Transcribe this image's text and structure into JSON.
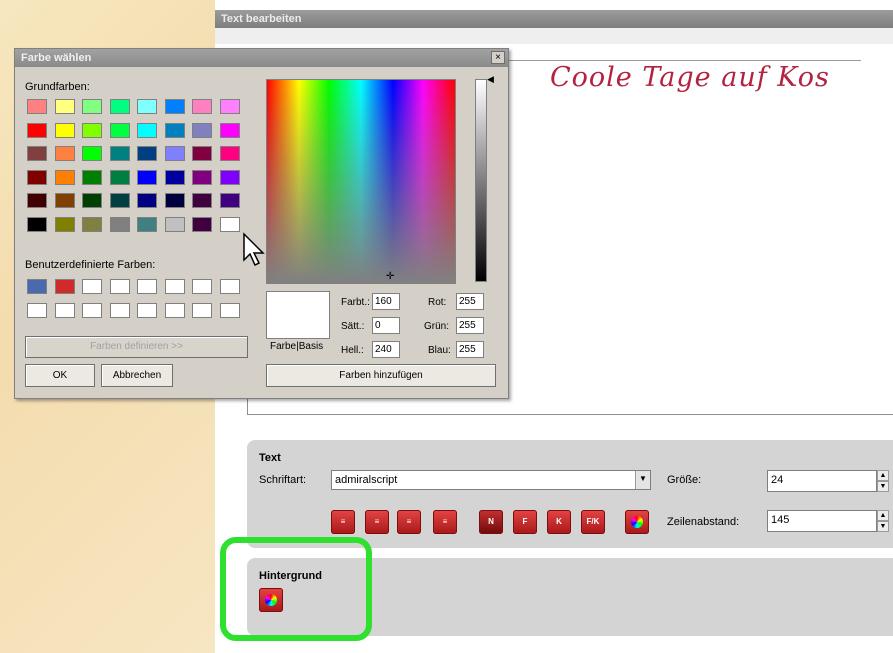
{
  "main_window": {
    "title": "Text bearbeiten",
    "canvas_text": "Coole Tage auf Kos"
  },
  "text_panel": {
    "heading": "Text",
    "font_label": "Schriftart:",
    "font_value": "admiralscript",
    "size_label": "Größe:",
    "size_value": "24",
    "line_spacing_label": "Zeilenabstand:",
    "line_spacing_value": "145",
    "format_buttons": [
      "align-left",
      "align-center",
      "align-right",
      "justify",
      "normal",
      "bold",
      "italic",
      "bold-italic",
      "color"
    ],
    "format_button_labels": [
      "≡",
      "≡",
      "≡",
      "≡",
      "N",
      "F",
      "K",
      "F/K",
      ""
    ]
  },
  "background_panel": {
    "heading": "Hintergrund"
  },
  "highlight_color": "#2fe02f",
  "color_dialog": {
    "title": "Farbe wählen",
    "close_label": "×",
    "basic_colors_label": "Grundfarben:",
    "basic_colors": [
      [
        "#ff8080",
        "#ffff80",
        "#80ff80",
        "#00ff80",
        "#80ffff",
        "#0080ff",
        "#ff80c0",
        "#ff80ff"
      ],
      [
        "#ff0000",
        "#ffff00",
        "#80ff00",
        "#00ff40",
        "#00ffff",
        "#0080c0",
        "#8080c0",
        "#ff00ff"
      ],
      [
        "#804040",
        "#ff8040",
        "#00ff00",
        "#008080",
        "#004080",
        "#8080ff",
        "#800040",
        "#ff0080"
      ],
      [
        "#800000",
        "#ff8000",
        "#008000",
        "#008040",
        "#0000ff",
        "#0000a0",
        "#800080",
        "#8000ff"
      ],
      [
        "#400000",
        "#804000",
        "#004000",
        "#004040",
        "#000080",
        "#000040",
        "#400040",
        "#400080"
      ],
      [
        "#000000",
        "#808000",
        "#808040",
        "#808080",
        "#408080",
        "#c0c0c0",
        "#400040",
        "#ffffff"
      ]
    ],
    "custom_colors_label": "Benutzerdefinierte Farben:",
    "custom_colors": [
      [
        "#4a6ab0",
        "#d02a2a",
        "#ffffff",
        "#ffffff",
        "#ffffff",
        "#ffffff",
        "#ffffff",
        "#ffffff"
      ],
      [
        "#ffffff",
        "#ffffff",
        "#ffffff",
        "#ffffff",
        "#ffffff",
        "#ffffff",
        "#ffffff",
        "#ffffff"
      ]
    ],
    "define_custom_label": "Farben definieren >>",
    "ok_label": "OK",
    "cancel_label": "Abbrechen",
    "color_solid_label": "Farbe|Basis",
    "hue_label": "Farbt.:",
    "hue_value": "160",
    "sat_label": "Sätt.:",
    "sat_value": "0",
    "lum_label": "Hell.:",
    "lum_value": "240",
    "red_label": "Rot:",
    "red_value": "255",
    "green_label": "Grün:",
    "green_value": "255",
    "blue_label": "Blau:",
    "blue_value": "255",
    "add_custom_label": "Farben hinzufügen"
  }
}
